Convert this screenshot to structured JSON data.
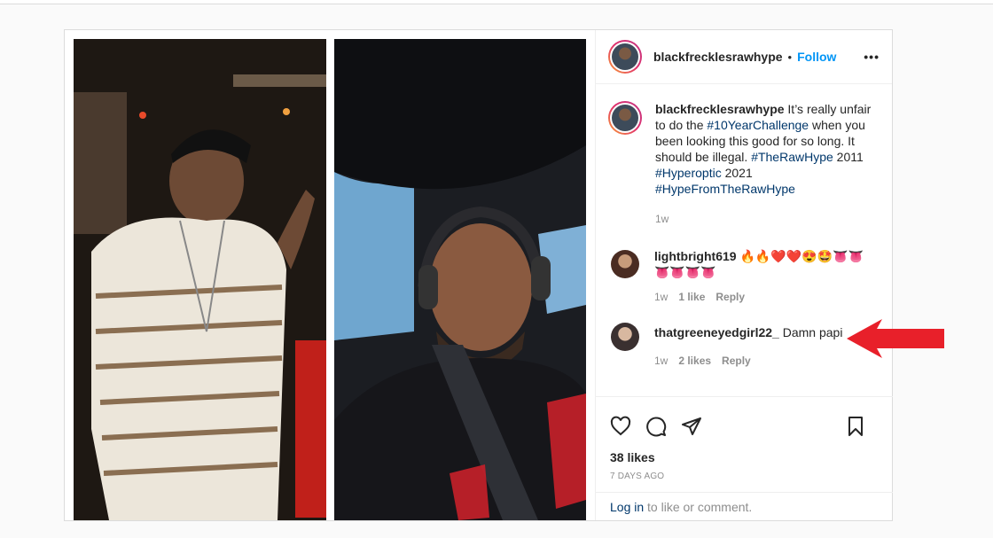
{
  "post": {
    "username": "blackfrecklesrawhype",
    "dot": "•",
    "follow_label": "Follow",
    "more_label": "•••",
    "caption": {
      "username": "blackfrecklesrawhype",
      "text1": " It’s really unfair to do the ",
      "tag1": "#10YearChallenge",
      "text2": " when you been looking this good for so long. It should be illegal. ",
      "tag2": "#TheRawHype",
      "text3": " 2011 ",
      "tag3": "#Hyperoptic",
      "text4": " 2021 ",
      "tag4": "#HypeFromTheRawHype",
      "time": "1w"
    },
    "comments": [
      {
        "username": "lightbright619",
        "text": " 🔥🔥❤️❤️😍🤩👅👅 👅👅👅👅",
        "time": "1w",
        "likes": "1 like",
        "reply": "Reply"
      },
      {
        "username": "thatgreeneyedgirl22_",
        "text": " Damn papi",
        "time": "1w",
        "likes": "2 likes",
        "reply": "Reply"
      }
    ],
    "likes_label": "38 likes",
    "date_label": "7 DAYS AGO",
    "login_link": "Log in",
    "login_text": " to like or comment."
  },
  "colors": {
    "accent": "#0095f6",
    "link": "#00376b",
    "arrow": "#e8202a"
  },
  "icons": [
    "more-icon",
    "heart-icon",
    "comment-icon",
    "share-icon",
    "bookmark-icon",
    "arrow-annotation-icon"
  ]
}
